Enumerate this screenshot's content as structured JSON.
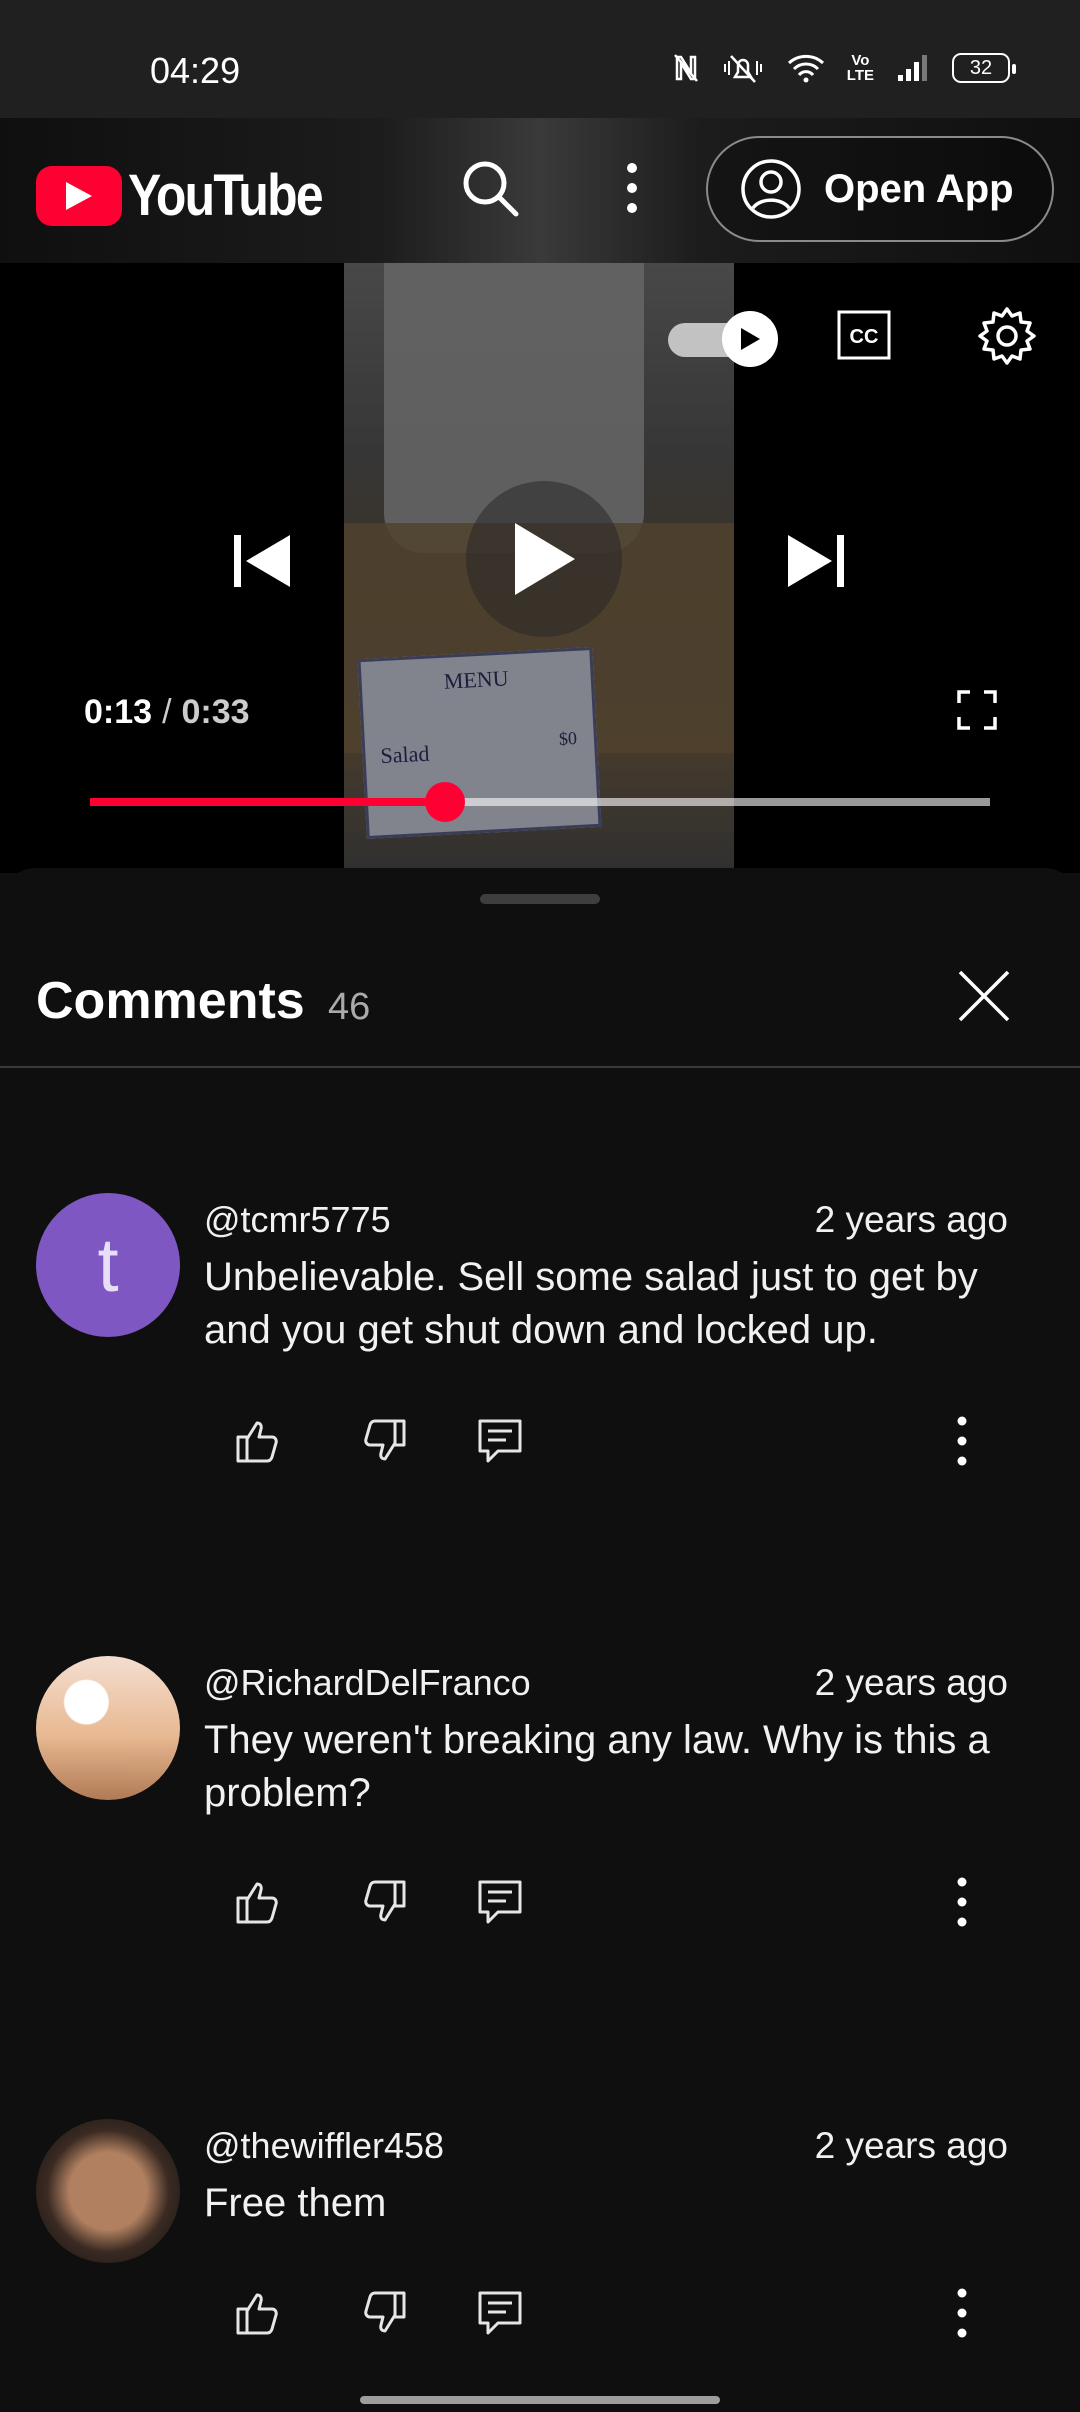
{
  "status_bar": {
    "time": "04:29",
    "battery": "32",
    "volte_top": "Vo",
    "volte_bottom": "LTE",
    "icons": [
      "nfc-icon",
      "mute-icon",
      "wifi-icon",
      "volte-icon",
      "signal-icon",
      "battery-icon"
    ]
  },
  "header": {
    "logo_text": "YouTube",
    "brand_color": "#ff0033",
    "search_icon": "search-icon",
    "more_icon": "more-vertical-icon",
    "open_app_label": "Open App"
  },
  "player": {
    "current_time": "0:13",
    "separator": "/",
    "duration": "0:33",
    "progress_fraction": 0.394,
    "autoplay_on": true,
    "frame_menu_title": "MENU",
    "frame_menu_item": "Salad",
    "frame_menu_price": "$0",
    "controls": [
      "autoplay-toggle",
      "cc-icon",
      "settings-icon",
      "previous-icon",
      "play-icon",
      "next-icon",
      "fullscreen-icon"
    ]
  },
  "comments": {
    "title": "Comments",
    "count": "46",
    "items": [
      {
        "avatar_letter": "t",
        "avatar_color": "#7e57c2",
        "author": "@tcmr5775",
        "time": "2 years ago",
        "text": "Unbelievable. Sell some salad just to get by and you get shut down and locked up."
      },
      {
        "author": "@RichardDelFranco",
        "time": "2 years ago",
        "text": "They weren't breaking any law. Why is this a problem?"
      },
      {
        "author": "@thewiffler458",
        "time": "2 years ago",
        "text": "Free them"
      }
    ]
  }
}
